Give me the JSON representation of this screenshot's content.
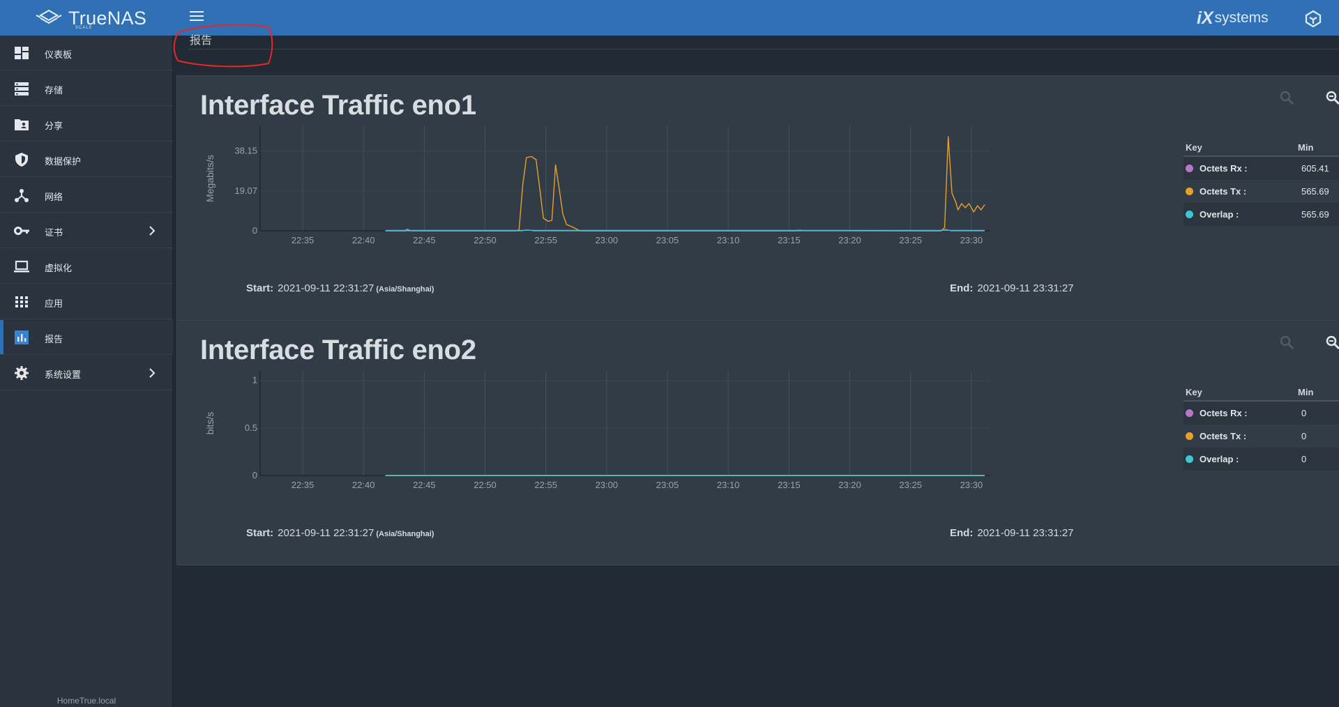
{
  "app": {
    "brand": "TrueNAS",
    "edition": "SCALE",
    "vendor_prefix": "iX",
    "vendor_rest": "systems",
    "hostname": "HomeTrue.local"
  },
  "sidebar": {
    "items": [
      {
        "label": "仪表板",
        "icon": "dashboard-icon"
      },
      {
        "label": "存储",
        "icon": "storage-icon"
      },
      {
        "label": "分享",
        "icon": "folder-shared-icon"
      },
      {
        "label": "数据保护",
        "icon": "shield-icon"
      },
      {
        "label": "网络",
        "icon": "network-icon"
      },
      {
        "label": "证书",
        "icon": "key-icon",
        "expandable": true
      },
      {
        "label": "虚拟化",
        "icon": "laptop-icon"
      },
      {
        "label": "应用",
        "icon": "apps-grid-icon"
      },
      {
        "label": "报告",
        "icon": "report-chart-icon",
        "active": true
      },
      {
        "label": "系统设置",
        "icon": "gear-icon",
        "expandable": true
      }
    ]
  },
  "page": {
    "crumb": "报告"
  },
  "colors": {
    "accent": "#3071b6",
    "rx": "#b679c8",
    "tx": "#e8a02c",
    "overlap": "#3ec7d2",
    "annotation": "#e8262a"
  },
  "charts": [
    {
      "title": "Interface Traffic eno1",
      "start_label": "Start:",
      "start_value": "2021-09-11 22:31:27",
      "timezone": "(Asia/Shanghai)",
      "end_label": "End:",
      "end_value": "2021-09-11 23:31:27",
      "legend": {
        "key_header": "Key",
        "min_header": "Min",
        "rows": [
          {
            "name": "Octets Rx :",
            "min": "605.41"
          },
          {
            "name": "Octets Tx :",
            "min": "565.69"
          },
          {
            "name": "Overlap :",
            "min": "565.69"
          }
        ]
      }
    },
    {
      "title": "Interface Traffic eno2",
      "start_label": "Start:",
      "start_value": "2021-09-11 22:31:27",
      "timezone": "(Asia/Shanghai)",
      "end_label": "End:",
      "end_value": "2021-09-11 23:31:27",
      "legend": {
        "key_header": "Key",
        "min_header": "Min",
        "rows": [
          {
            "name": "Octets Rx :",
            "min": "0"
          },
          {
            "name": "Octets Tx :",
            "min": "0"
          },
          {
            "name": "Overlap :",
            "min": "0"
          }
        ]
      }
    }
  ],
  "chart_data": [
    {
      "type": "line",
      "ylabel": "Megabits/s",
      "ylim": [
        0,
        50
      ],
      "yticks": [
        "0",
        "19.07",
        "38.15"
      ],
      "ytick_values": [
        0,
        19.07,
        38.15
      ],
      "xticks": [
        "22:35",
        "22:40",
        "22:45",
        "22:50",
        "22:55",
        "23:00",
        "23:05",
        "23:10",
        "23:15",
        "23:20",
        "23:25",
        "23:30"
      ],
      "xlim_minutes": [
        31.5,
        91.5
      ],
      "data_start_minute": 41.8,
      "grid": true,
      "series": [
        {
          "name": "Octets Tx",
          "color": "#e8a02c",
          "points": [
            [
              41.8,
              0
            ],
            [
              52.5,
              0
            ],
            [
              52.8,
              0.5
            ],
            [
              53.1,
              22
            ],
            [
              53.4,
              35
            ],
            [
              53.8,
              35.5
            ],
            [
              54.2,
              34
            ],
            [
              54.5,
              20
            ],
            [
              54.8,
              6
            ],
            [
              55.2,
              4.5
            ],
            [
              55.5,
              5
            ],
            [
              55.8,
              31.5
            ],
            [
              56.1,
              20
            ],
            [
              56.4,
              8
            ],
            [
              56.7,
              3
            ],
            [
              57.2,
              1.8
            ],
            [
              57.8,
              0
            ],
            [
              75.5,
              0
            ],
            [
              75.9,
              0.3
            ],
            [
              76.2,
              0.1
            ],
            [
              87.5,
              0
            ],
            [
              87.8,
              1.5
            ],
            [
              88.1,
              45
            ],
            [
              88.4,
              18
            ],
            [
              88.7,
              14
            ],
            [
              88.9,
              10
            ],
            [
              89.2,
              13
            ],
            [
              89.5,
              11
            ],
            [
              89.8,
              13
            ],
            [
              90.2,
              9
            ],
            [
              90.5,
              12
            ],
            [
              90.8,
              10
            ],
            [
              91.1,
              12.5
            ]
          ]
        },
        {
          "name": "Octets Rx",
          "color": "#b679c8",
          "points": [
            [
              41.8,
              0.2
            ],
            [
              91.1,
              0.2
            ]
          ]
        },
        {
          "name": "Overlap",
          "color": "#3ec7d2",
          "points": [
            [
              41.8,
              0
            ],
            [
              43.4,
              0
            ],
            [
              43.6,
              0.8
            ],
            [
              43.9,
              0
            ],
            [
              53.0,
              0
            ],
            [
              53.5,
              0.4
            ],
            [
              54,
              0
            ],
            [
              87.5,
              0
            ],
            [
              87.9,
              0.6
            ],
            [
              88.3,
              0
            ],
            [
              91.1,
              0
            ]
          ]
        }
      ]
    },
    {
      "type": "line",
      "ylabel": "bits/s",
      "ylim": [
        0,
        1.1
      ],
      "yticks": [
        "0",
        "0.5",
        "1"
      ],
      "ytick_values": [
        0,
        0.5,
        1
      ],
      "xticks": [
        "22:35",
        "22:40",
        "22:45",
        "22:50",
        "22:55",
        "23:00",
        "23:05",
        "23:10",
        "23:15",
        "23:20",
        "23:25",
        "23:30"
      ],
      "xlim_minutes": [
        31.5,
        91.5
      ],
      "data_start_minute": 41.8,
      "grid": true,
      "series": [
        {
          "name": "Octets Rx",
          "color": "#b679c8",
          "points": [
            [
              41.8,
              0
            ],
            [
              91.1,
              0
            ]
          ]
        },
        {
          "name": "Octets Tx",
          "color": "#e8a02c",
          "points": [
            [
              41.8,
              0
            ],
            [
              91.1,
              0
            ]
          ]
        },
        {
          "name": "Overlap",
          "color": "#3ec7d2",
          "points": [
            [
              41.8,
              0
            ],
            [
              91.1,
              0
            ]
          ]
        }
      ]
    }
  ]
}
